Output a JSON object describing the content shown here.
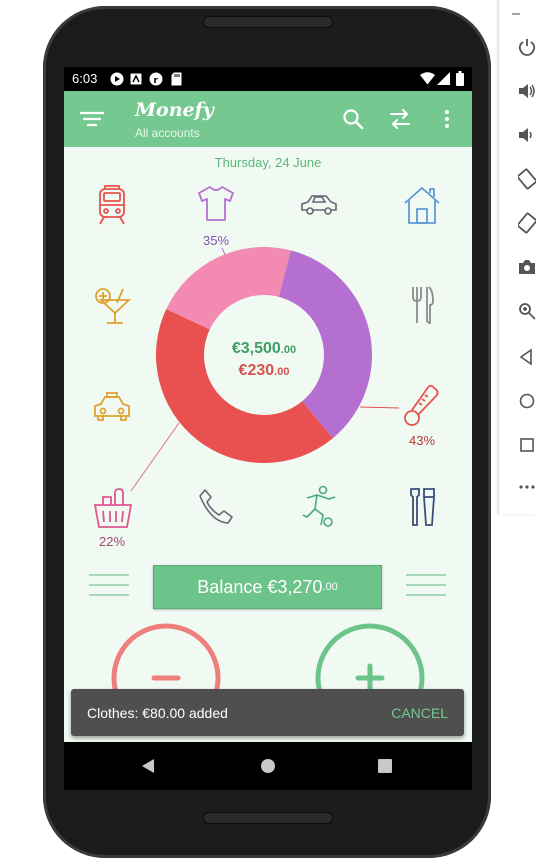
{
  "status": {
    "time": "6:03"
  },
  "appbar": {
    "title": "Monefy",
    "subtitle": "All accounts"
  },
  "date": "Thursday, 24 June",
  "categories": {
    "clothes_pct": "35%",
    "health_pct": "43%",
    "food_pct": "22%"
  },
  "donut": {
    "income_main": "€3,500",
    "income_cents": ".00",
    "expense_main": "€230",
    "expense_cents": ".00"
  },
  "chart_data": {
    "type": "pie",
    "title": "",
    "categories": [
      "Health",
      "Food",
      "Clothes"
    ],
    "values": [
      43,
      22,
      35
    ],
    "colors": [
      "#e8514f",
      "#f28ab2",
      "#b46fd1"
    ]
  },
  "balance": {
    "label": "Balance €3,270",
    "cents": ".00"
  },
  "snackbar": {
    "message": "Clothes: €80.00 added",
    "action": "CANCEL"
  },
  "colors": {
    "primary": "#76c891",
    "expense": "#e8514f",
    "income": "#6cc48a",
    "background": "#f0faf2"
  }
}
